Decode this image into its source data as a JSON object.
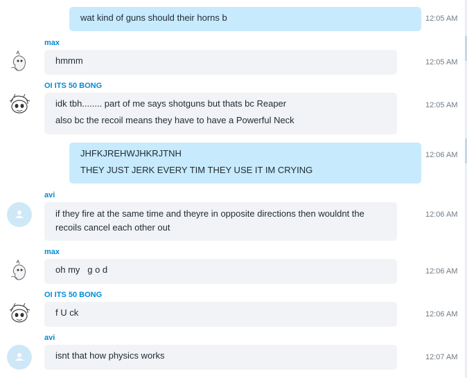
{
  "messages": [
    {
      "sender": "",
      "direction": "out",
      "lines": [
        "wat kind of guns should their horns b"
      ],
      "time": "12:05 AM"
    },
    {
      "sender": "max",
      "avatar": "sketch-ghost-icon",
      "direction": "in",
      "lines": [
        "hmmm"
      ],
      "time": "12:05 AM"
    },
    {
      "sender": "OI ITS 50 BONG",
      "avatar": "sketch-face-icon",
      "direction": "in",
      "lines": [
        "idk tbh........ part of me says shotguns but thats bc Reaper",
        "also bc the recoil means they have to have a Powerful Neck"
      ],
      "time": "12:05 AM"
    },
    {
      "sender": "",
      "direction": "out",
      "lines": [
        "JHFKJREHWJHKRJTNH",
        "THEY JUST JERK EVERY TIM THEY USE IT IM CRYING"
      ],
      "time": "12:06 AM"
    },
    {
      "sender": "avi",
      "avatar": "default-user-icon",
      "direction": "in",
      "lines": [
        "if they fire at the same time and theyre in opposite directions then wouldnt the",
        "recoils cancel each other out"
      ],
      "time": "12:06 AM"
    },
    {
      "sender": "max",
      "avatar": "sketch-ghost-icon",
      "direction": "in",
      "lines": [
        "oh my   g o d"
      ],
      "time": "12:06 AM"
    },
    {
      "sender": "OI ITS 50 BONG",
      "avatar": "sketch-face-icon",
      "direction": "in",
      "lines": [
        "f U ck"
      ],
      "time": "12:06 AM"
    },
    {
      "sender": "avi",
      "avatar": "default-user-icon",
      "direction": "in",
      "lines": [
        "isnt that how physics works"
      ],
      "time": "12:07 AM"
    }
  ],
  "colors": {
    "sender": "#008bd6",
    "incoming_bubble": "#f1f3f6",
    "outgoing_bubble": "#c7eafd",
    "time": "#6f7b86"
  }
}
